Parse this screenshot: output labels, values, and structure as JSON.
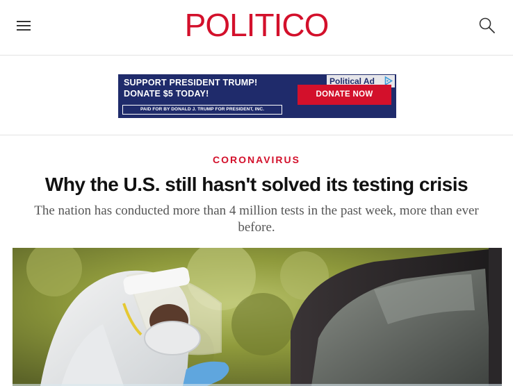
{
  "header": {
    "logo": "POLITICO"
  },
  "ad": {
    "headline_line1": "SUPPORT PRESIDENT TRUMP!",
    "headline_line2": "DONATE $5 TODAY!",
    "label": "Political Ad",
    "cta": "DONATE NOW",
    "paid_for": "PAID FOR BY DONALD J. TRUMP FOR PRESIDENT, INC."
  },
  "article": {
    "kicker": "CORONAVIRUS",
    "headline": "Why the U.S. still hasn't solved its testing crisis",
    "dek": "The nation has conducted more than 4 million tests in the past week, more than ever before."
  },
  "colors": {
    "brand_red": "#d3102b",
    "ad_navy": "#1f2b6b"
  },
  "icons": [
    "hamburger-menu-icon",
    "search-icon",
    "adchoices-icon"
  ]
}
